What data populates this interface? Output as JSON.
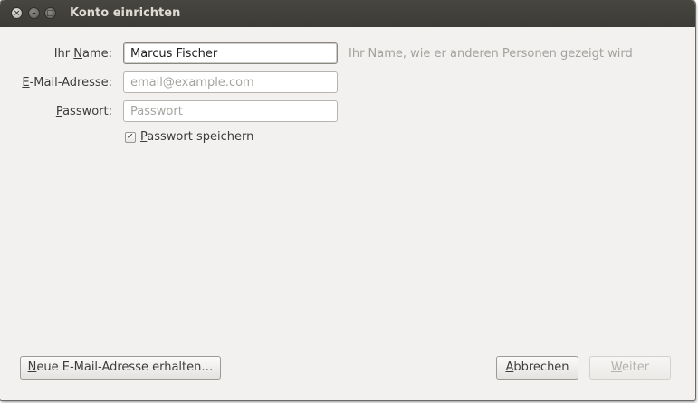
{
  "window": {
    "title": "Konto einrichten",
    "close_glyph": "×",
    "min_glyph": "–",
    "max_glyph": "□"
  },
  "form": {
    "name_label_pre": "Ihr ",
    "name_label_key": "N",
    "name_label_post": "ame:",
    "name_value": "Marcus Fischer",
    "name_hint": "Ihr Name, wie er anderen Personen gezeigt wird",
    "email_label_key": "E",
    "email_label_post": "-Mail-Adresse:",
    "email_placeholder": "email@example.com",
    "password_label_key": "P",
    "password_label_post": "asswort:",
    "password_placeholder": "Passwort",
    "remember_checked": true,
    "remember_check_glyph": "✓",
    "remember_label_key": "P",
    "remember_label_post": "asswort speichern"
  },
  "buttons": {
    "new_address_key": "N",
    "new_address_post": "eue E-Mail-Adresse erhalten…",
    "cancel_key": "A",
    "cancel_post": "bbrechen",
    "next_key": "W",
    "next_post": "eiter"
  },
  "icons": {
    "close": "close-icon",
    "minimize": "minimize-icon",
    "maximize": "maximize-icon",
    "checkbox": "check-icon"
  }
}
